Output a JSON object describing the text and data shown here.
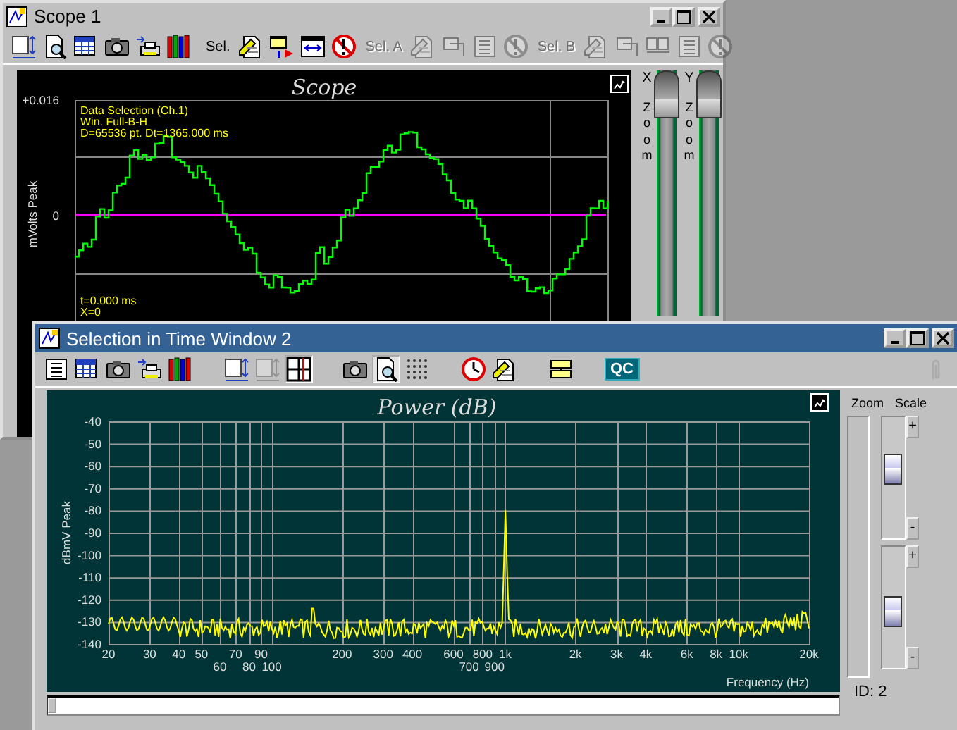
{
  "scope_window": {
    "title": "Scope 1",
    "active": false,
    "toolbar": [
      {
        "kind": "icon",
        "disabled": false
      },
      {
        "kind": "icon",
        "disabled": false
      },
      {
        "kind": "icon",
        "disabled": false
      },
      {
        "kind": "icon",
        "disabled": false
      },
      {
        "kind": "icon",
        "disabled": false
      },
      {
        "kind": "icon",
        "disabled": false
      },
      {
        "kind": "label",
        "text": "Sel.",
        "disabled": false
      },
      {
        "kind": "icon",
        "disabled": false
      },
      {
        "kind": "icon",
        "disabled": false
      },
      {
        "kind": "icon",
        "disabled": false
      },
      {
        "kind": "icon",
        "disabled": false
      },
      {
        "kind": "label",
        "text": "Sel. A",
        "disabled": true
      },
      {
        "kind": "icon",
        "disabled": true
      },
      {
        "kind": "icon",
        "disabled": true
      },
      {
        "kind": "icon",
        "disabled": true
      },
      {
        "kind": "icon",
        "disabled": true
      },
      {
        "kind": "label",
        "text": "Sel. B",
        "disabled": true
      },
      {
        "kind": "icon",
        "disabled": true
      },
      {
        "kind": "icon",
        "disabled": true
      },
      {
        "kind": "icon",
        "disabled": true
      },
      {
        "kind": "icon",
        "disabled": true
      },
      {
        "kind": "icon",
        "disabled": true
      }
    ],
    "chart": {
      "title": "Scope",
      "ylabel": "mVolts Peak",
      "yticks": [
        "+0.016",
        "0"
      ],
      "info": [
        "Data Selection (Ch.1)",
        "Win. Full-B-H",
        "D=65536 pt. Dt=1365.000 ms"
      ],
      "cursor": [
        "t=0.000 ms",
        "X=0"
      ]
    },
    "zoom_sliders": [
      {
        "axis": "X",
        "label": "Zoom",
        "level": 1
      },
      {
        "axis": "Y",
        "label": "Zoom",
        "level": 1
      }
    ]
  },
  "selection_window": {
    "title": "Selection in Time Window 2",
    "active": true,
    "toolbar": [
      {
        "kind": "icon",
        "disabled": false,
        "pressed": false
      },
      {
        "kind": "icon",
        "disabled": false,
        "pressed": false
      },
      {
        "kind": "icon",
        "disabled": false,
        "pressed": false
      },
      {
        "kind": "icon",
        "disabled": false,
        "pressed": false
      },
      {
        "kind": "icon",
        "disabled": false,
        "pressed": false
      },
      {
        "kind": "icon",
        "disabled": false,
        "pressed": false
      },
      {
        "kind": "icon",
        "disabled": true,
        "pressed": false
      },
      {
        "kind": "icon",
        "disabled": false,
        "pressed": true
      },
      {
        "kind": "icon",
        "disabled": false,
        "pressed": false
      },
      {
        "kind": "icon",
        "disabled": false,
        "pressed": true
      },
      {
        "kind": "icon",
        "disabled": false,
        "pressed": false
      },
      {
        "kind": "icon",
        "disabled": false,
        "pressed": false
      },
      {
        "kind": "icon",
        "disabled": false,
        "pressed": false
      },
      {
        "kind": "icon",
        "disabled": false,
        "pressed": false
      },
      {
        "kind": "label",
        "text": "QC",
        "disabled": false
      },
      {
        "kind": "icon",
        "disabled": true,
        "pressed": false
      }
    ],
    "chart": {
      "title": "Power (dB)",
      "ylabel": "dBmV Peak",
      "xlabel": "Frequency (Hz)",
      "yticks": [
        "-40",
        "-50",
        "-60",
        "-70",
        "-80",
        "-90",
        "-100",
        "-110",
        "-120",
        "-130",
        "-140"
      ],
      "xticks": [
        "20",
        "30",
        "40",
        "50",
        "70",
        "90",
        "200",
        "300",
        "400",
        "600",
        "800",
        "1k",
        "2k",
        "3k",
        "4k",
        "6k",
        "8k",
        "10k",
        "20k",
        "60",
        "80",
        "100",
        "700",
        "900"
      ]
    },
    "side": {
      "zoom_label": "Zoom",
      "scale_label": "Scale",
      "scale_sliders": [
        {
          "plus": "+",
          "minus": "-",
          "level": 0.6
        },
        {
          "plus": "+",
          "minus": "-",
          "level": 0.45
        }
      ],
      "id_label": "ID: 2"
    }
  }
}
